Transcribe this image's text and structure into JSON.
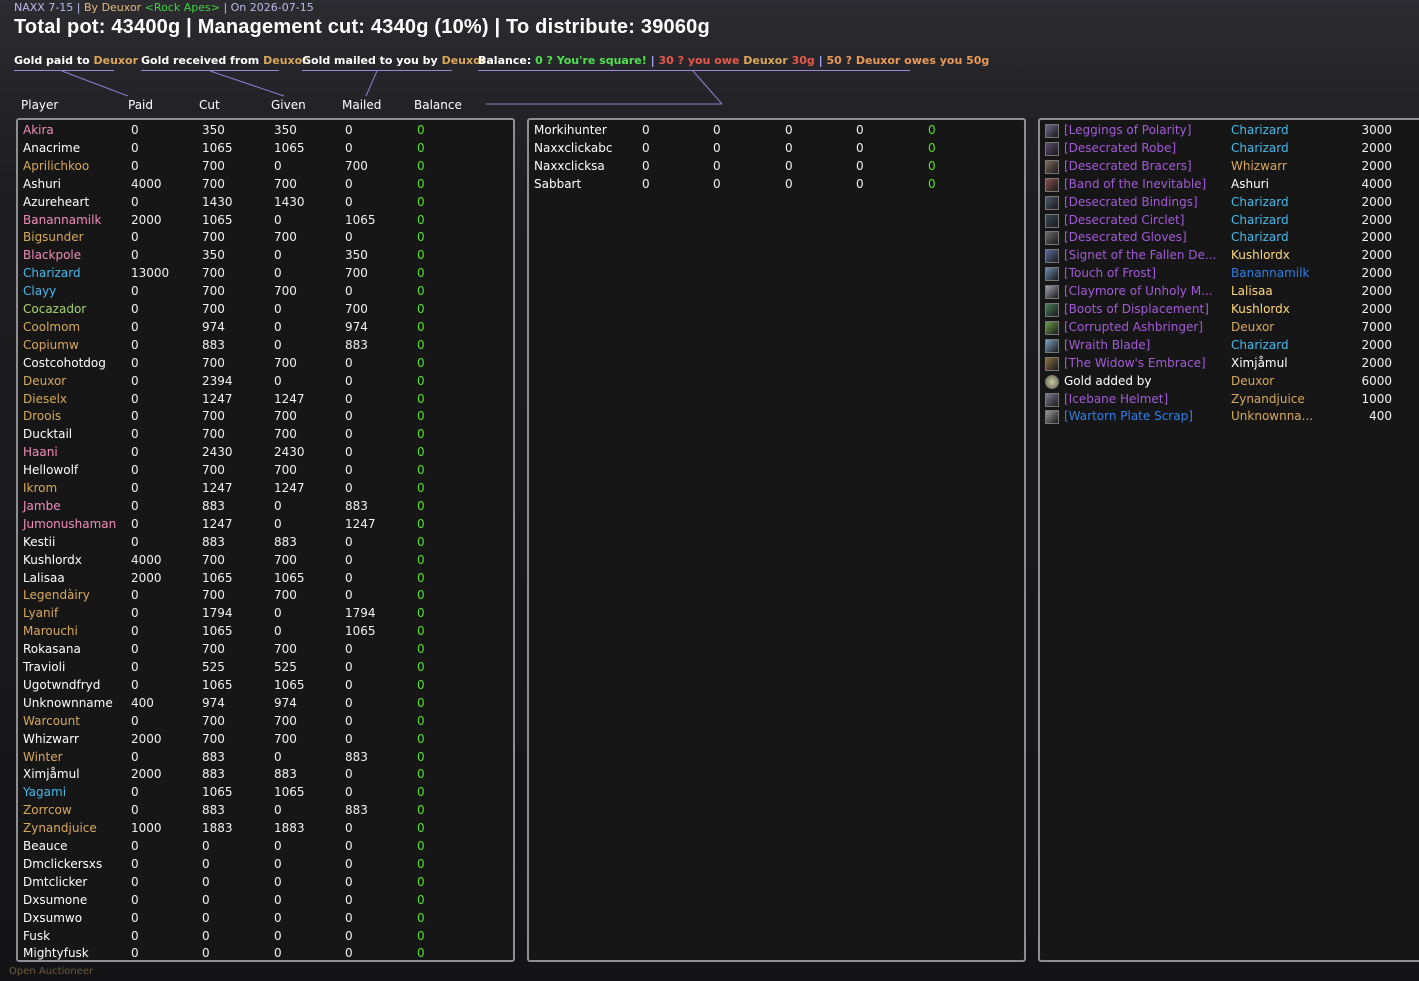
{
  "header": {
    "raid": "NAXX 7-15",
    "by_prefix": "By",
    "author": "Deuxor",
    "guild": "<Rock Apes>",
    "date_prefix": "On",
    "date": "2026-07-15",
    "title": "Total pot: 43400g | Management cut: 4340g (10%) | To distribute: 39060g"
  },
  "legend": {
    "paid_label": "Gold paid to",
    "paid_name": "Deuxor",
    "received_label": "Gold received from",
    "received_name": "Deuxor",
    "mailed_label": "Gold mailed to you by",
    "mailed_name": "Deuxor",
    "balance_label": "Balance:",
    "square": "0 ? You're square!",
    "sep": "|",
    "owe": "30 ? you owe",
    "owe_name": "Deuxor",
    "owe_amt": "30g",
    "owes": "50 ? Deuxor owes you 50g"
  },
  "columns": [
    "Player",
    "Paid",
    "Cut",
    "Given",
    "Mailed",
    "Balance"
  ],
  "colors": {
    "gold": "#d9a85c",
    "pink": "#f18cba",
    "white": "#ffffff",
    "cyan": "#49b9ea",
    "green": "#a9d46c",
    "blue": "#2f7fe8",
    "purple": "#a45ad8",
    "yellow": "#ffd87a",
    "balance": "#56e02a"
  },
  "players_left": [
    {
      "name": "Akira",
      "c": "pink",
      "paid": "0",
      "cut": "350",
      "given": "350",
      "mailed": "0",
      "balance": "0"
    },
    {
      "name": "Anacrime",
      "c": "white",
      "paid": "0",
      "cut": "1065",
      "given": "1065",
      "mailed": "0",
      "balance": "0"
    },
    {
      "name": "Aprilichkoo",
      "c": "gold",
      "paid": "0",
      "cut": "700",
      "given": "0",
      "mailed": "700",
      "balance": "0"
    },
    {
      "name": "Ashuri",
      "c": "white",
      "paid": "4000",
      "cut": "700",
      "given": "700",
      "mailed": "0",
      "balance": "0"
    },
    {
      "name": "Azureheart",
      "c": "white",
      "paid": "0",
      "cut": "1430",
      "given": "1430",
      "mailed": "0",
      "balance": "0"
    },
    {
      "name": "Banannamilk",
      "c": "pink",
      "paid": "2000",
      "cut": "1065",
      "given": "0",
      "mailed": "1065",
      "balance": "0"
    },
    {
      "name": "Bigsunder",
      "c": "gold",
      "paid": "0",
      "cut": "700",
      "given": "700",
      "mailed": "0",
      "balance": "0"
    },
    {
      "name": "Blackpole",
      "c": "pink",
      "paid": "0",
      "cut": "350",
      "given": "0",
      "mailed": "350",
      "balance": "0"
    },
    {
      "name": "Charizard",
      "c": "cyan",
      "paid": "13000",
      "cut": "700",
      "given": "0",
      "mailed": "700",
      "balance": "0"
    },
    {
      "name": "Clayy",
      "c": "cyan",
      "paid": "0",
      "cut": "700",
      "given": "700",
      "mailed": "0",
      "balance": "0"
    },
    {
      "name": "Cocazador",
      "c": "green",
      "paid": "0",
      "cut": "700",
      "given": "0",
      "mailed": "700",
      "balance": "0"
    },
    {
      "name": "Coolmom",
      "c": "gold",
      "paid": "0",
      "cut": "974",
      "given": "0",
      "mailed": "974",
      "balance": "0"
    },
    {
      "name": "Copiumw",
      "c": "gold",
      "paid": "0",
      "cut": "883",
      "given": "0",
      "mailed": "883",
      "balance": "0"
    },
    {
      "name": "Costcohotdog",
      "c": "white",
      "paid": "0",
      "cut": "700",
      "given": "700",
      "mailed": "0",
      "balance": "0"
    },
    {
      "name": "Deuxor",
      "c": "gold",
      "paid": "0",
      "cut": "2394",
      "given": "0",
      "mailed": "0",
      "balance": "0"
    },
    {
      "name": "Dieselx",
      "c": "gold",
      "paid": "0",
      "cut": "1247",
      "given": "1247",
      "mailed": "0",
      "balance": "0"
    },
    {
      "name": "Droois",
      "c": "gold",
      "paid": "0",
      "cut": "700",
      "given": "700",
      "mailed": "0",
      "balance": "0"
    },
    {
      "name": "Ducktail",
      "c": "white",
      "paid": "0",
      "cut": "700",
      "given": "700",
      "mailed": "0",
      "balance": "0"
    },
    {
      "name": "Haani",
      "c": "pink",
      "paid": "0",
      "cut": "2430",
      "given": "2430",
      "mailed": "0",
      "balance": "0"
    },
    {
      "name": "Hellowolf",
      "c": "white",
      "paid": "0",
      "cut": "700",
      "given": "700",
      "mailed": "0",
      "balance": "0"
    },
    {
      "name": "Ikrom",
      "c": "gold",
      "paid": "0",
      "cut": "1247",
      "given": "1247",
      "mailed": "0",
      "balance": "0"
    },
    {
      "name": "Jambe",
      "c": "pink",
      "paid": "0",
      "cut": "883",
      "given": "0",
      "mailed": "883",
      "balance": "0"
    },
    {
      "name": "Jumonushaman",
      "c": "pink",
      "paid": "0",
      "cut": "1247",
      "given": "0",
      "mailed": "1247",
      "balance": "0"
    },
    {
      "name": "Kestii",
      "c": "white",
      "paid": "0",
      "cut": "883",
      "given": "883",
      "mailed": "0",
      "balance": "0"
    },
    {
      "name": "Kushlordx",
      "c": "white",
      "paid": "4000",
      "cut": "700",
      "given": "700",
      "mailed": "0",
      "balance": "0"
    },
    {
      "name": "Lalisaa",
      "c": "white",
      "paid": "2000",
      "cut": "1065",
      "given": "1065",
      "mailed": "0",
      "balance": "0"
    },
    {
      "name": "Legendàiry",
      "c": "gold",
      "paid": "0",
      "cut": "700",
      "given": "700",
      "mailed": "0",
      "balance": "0"
    },
    {
      "name": "Lyanif",
      "c": "gold",
      "paid": "0",
      "cut": "1794",
      "given": "0",
      "mailed": "1794",
      "balance": "0"
    },
    {
      "name": "Marouchi",
      "c": "gold",
      "paid": "0",
      "cut": "1065",
      "given": "0",
      "mailed": "1065",
      "balance": "0"
    },
    {
      "name": "Rokasana",
      "c": "white",
      "paid": "0",
      "cut": "700",
      "given": "700",
      "mailed": "0",
      "balance": "0"
    },
    {
      "name": "Travioli",
      "c": "white",
      "paid": "0",
      "cut": "525",
      "given": "525",
      "mailed": "0",
      "balance": "0"
    },
    {
      "name": "Ugotwndfryd",
      "c": "white",
      "paid": "0",
      "cut": "1065",
      "given": "1065",
      "mailed": "0",
      "balance": "0"
    },
    {
      "name": "Unknownname",
      "c": "white",
      "paid": "400",
      "cut": "974",
      "given": "974",
      "mailed": "0",
      "balance": "0"
    },
    {
      "name": "Warcount",
      "c": "gold",
      "paid": "0",
      "cut": "700",
      "given": "700",
      "mailed": "0",
      "balance": "0"
    },
    {
      "name": "Whizwarr",
      "c": "white",
      "paid": "2000",
      "cut": "700",
      "given": "700",
      "mailed": "0",
      "balance": "0"
    },
    {
      "name": "Winter",
      "c": "gold",
      "paid": "0",
      "cut": "883",
      "given": "0",
      "mailed": "883",
      "balance": "0"
    },
    {
      "name": "Ximjåmul",
      "c": "white",
      "paid": "2000",
      "cut": "883",
      "given": "883",
      "mailed": "0",
      "balance": "0"
    },
    {
      "name": "Yagami",
      "c": "cyan",
      "paid": "0",
      "cut": "1065",
      "given": "1065",
      "mailed": "0",
      "balance": "0"
    },
    {
      "name": "Zorrcow",
      "c": "gold",
      "paid": "0",
      "cut": "883",
      "given": "0",
      "mailed": "883",
      "balance": "0"
    },
    {
      "name": "Zynandjuice",
      "c": "gold",
      "paid": "1000",
      "cut": "1883",
      "given": "1883",
      "mailed": "0",
      "balance": "0"
    },
    {
      "name": "Beauce",
      "c": "white",
      "paid": "0",
      "cut": "0",
      "given": "0",
      "mailed": "0",
      "balance": "0"
    },
    {
      "name": "Dmclickersxs",
      "c": "white",
      "paid": "0",
      "cut": "0",
      "given": "0",
      "mailed": "0",
      "balance": "0"
    },
    {
      "name": "Dmtclicker",
      "c": "white",
      "paid": "0",
      "cut": "0",
      "given": "0",
      "mailed": "0",
      "balance": "0"
    },
    {
      "name": "Dxsumone",
      "c": "white",
      "paid": "0",
      "cut": "0",
      "given": "0",
      "mailed": "0",
      "balance": "0"
    },
    {
      "name": "Dxsumwo",
      "c": "white",
      "paid": "0",
      "cut": "0",
      "given": "0",
      "mailed": "0",
      "balance": "0"
    },
    {
      "name": "Fusk",
      "c": "white",
      "paid": "0",
      "cut": "0",
      "given": "0",
      "mailed": "0",
      "balance": "0"
    },
    {
      "name": "Mightyfusk",
      "c": "white",
      "paid": "0",
      "cut": "0",
      "given": "0",
      "mailed": "0",
      "balance": "0"
    }
  ],
  "players_mid": [
    {
      "name": "Morkihunter",
      "c": "white",
      "paid": "0",
      "cut": "0",
      "given": "0",
      "mailed": "0",
      "balance": "0"
    },
    {
      "name": "Naxxclickabc",
      "c": "white",
      "paid": "0",
      "cut": "0",
      "given": "0",
      "mailed": "0",
      "balance": "0"
    },
    {
      "name": "Naxxclicksa",
      "c": "white",
      "paid": "0",
      "cut": "0",
      "given": "0",
      "mailed": "0",
      "balance": "0"
    },
    {
      "name": "Sabbart",
      "c": "white",
      "paid": "0",
      "cut": "0",
      "given": "0",
      "mailed": "0",
      "balance": "0"
    }
  ],
  "loot": [
    {
      "item": "[Leggings of Polarity]",
      "ic": "purple",
      "winner": "Charizard",
      "wc": "cyan",
      "amount": "3000",
      "icon": "leggings-icon"
    },
    {
      "item": "[Desecrated Robe]",
      "ic": "purple",
      "winner": "Charizard",
      "wc": "cyan",
      "amount": "2000",
      "icon": "robe-icon"
    },
    {
      "item": "[Desecrated Bracers]",
      "ic": "purple",
      "winner": "Whizwarr",
      "wc": "gold",
      "amount": "2000",
      "icon": "bracers-icon"
    },
    {
      "item": "[Band of the Inevitable]",
      "ic": "purple",
      "winner": "Ashuri",
      "wc": "white",
      "amount": "4000",
      "icon": "ring-icon"
    },
    {
      "item": "[Desecrated Bindings]",
      "ic": "purple",
      "winner": "Charizard",
      "wc": "cyan",
      "amount": "2000",
      "icon": "bindings-icon"
    },
    {
      "item": "[Desecrated Circlet]",
      "ic": "purple",
      "winner": "Charizard",
      "wc": "cyan",
      "amount": "2000",
      "icon": "circlet-icon"
    },
    {
      "item": "[Desecrated Gloves]",
      "ic": "purple",
      "winner": "Charizard",
      "wc": "cyan",
      "amount": "2000",
      "icon": "gloves-icon"
    },
    {
      "item": "[Signet of the Fallen De...",
      "ic": "purple",
      "winner": "Kushlordx",
      "wc": "yellow",
      "amount": "2000",
      "icon": "signet-icon"
    },
    {
      "item": "[Touch of Frost]",
      "ic": "purple",
      "winner": "Banannamilk",
      "wc": "blue",
      "amount": "2000",
      "icon": "frost-icon"
    },
    {
      "item": "[Claymore of Unholy M...",
      "ic": "purple",
      "winner": "Lalisaa",
      "wc": "yellow",
      "amount": "2000",
      "icon": "sword-icon"
    },
    {
      "item": "[Boots of Displacement]",
      "ic": "purple",
      "winner": "Kushlordx",
      "wc": "yellow",
      "amount": "2000",
      "icon": "boots-icon"
    },
    {
      "item": "[Corrupted Ashbringer]",
      "ic": "purple",
      "winner": "Deuxor",
      "wc": "gold",
      "amount": "7000",
      "icon": "sword-icon"
    },
    {
      "item": "[Wraith Blade]",
      "ic": "purple",
      "winner": "Charizard",
      "wc": "cyan",
      "amount": "2000",
      "icon": "blade-icon"
    },
    {
      "item": "[The Widow's Embrace]",
      "ic": "purple",
      "winner": "Ximjåmul",
      "wc": "white",
      "amount": "2000",
      "icon": "staff-icon"
    },
    {
      "item": "Gold added by",
      "ic": "white",
      "winner": "Deuxor",
      "wc": "gold",
      "amount": "6000",
      "icon": "coin-icon"
    },
    {
      "item": "[Icebane Helmet]",
      "ic": "purple",
      "winner": "Zynandjuice",
      "wc": "gold",
      "amount": "1000",
      "icon": "helmet-icon"
    },
    {
      "item": "[Wartorn Plate Scrap]",
      "ic": "blue",
      "winner": "Unknownna...",
      "wc": "gold",
      "amount": "400",
      "icon": "scrap-icon"
    }
  ],
  "footer": "Open Auctioneer"
}
